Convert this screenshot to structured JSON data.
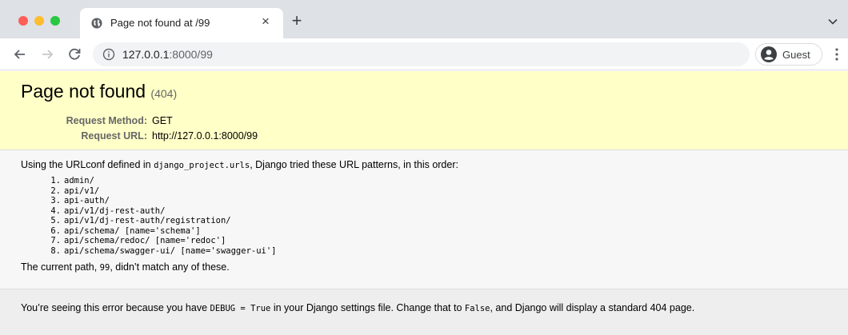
{
  "browser": {
    "tab": {
      "title": "Page not found at /99",
      "close_glyph": "×"
    },
    "new_tab_glyph": "+",
    "address": {
      "host": "127.0.0.1",
      "rest": ":8000/99"
    },
    "profile": {
      "label": "Guest"
    },
    "colors": {
      "tab_strip": "#dee1e6",
      "omnibox": "#f1f3f4"
    }
  },
  "error": {
    "title": "Page not found",
    "code": "(404)",
    "meta": [
      {
        "label": "Request Method:",
        "value": "GET"
      },
      {
        "label": "Request URL:",
        "value": "http://127.0.0.1:8000/99"
      }
    ]
  },
  "info": {
    "intro_prefix": "Using the URLconf defined in ",
    "urlconf": "django_project.urls",
    "intro_suffix": ", Django tried these URL patterns, in this order:",
    "patterns": [
      {
        "num": "1.",
        "text": "admin/"
      },
      {
        "num": "2.",
        "text": "api/v1/"
      },
      {
        "num": "3.",
        "text": "api-auth/"
      },
      {
        "num": "4.",
        "text": "api/v1/dj-rest-auth/"
      },
      {
        "num": "5.",
        "text": "api/v1/dj-rest-auth/registration/"
      },
      {
        "num": "6.",
        "text": "api/schema/ [name='schema']"
      },
      {
        "num": "7.",
        "text": "api/schema/redoc/ [name='redoc']"
      },
      {
        "num": "8.",
        "text": "api/schema/swagger-ui/ [name='swagger-ui']"
      }
    ],
    "path_prefix": "The current path, ",
    "path": "99",
    "path_suffix": ", didn’t match any of these."
  },
  "explanation": {
    "part1": "You’re seeing this error because you have ",
    "debug_code": "DEBUG = True",
    "part2": " in your Django settings file. Change that to ",
    "false_code": "False",
    "part3": ", and Django will display a standard 404 page."
  },
  "colors": {
    "summary_bg": "#ffffc8",
    "info_bg": "#f7f7f7",
    "explanation_bg": "#eeeeee"
  }
}
